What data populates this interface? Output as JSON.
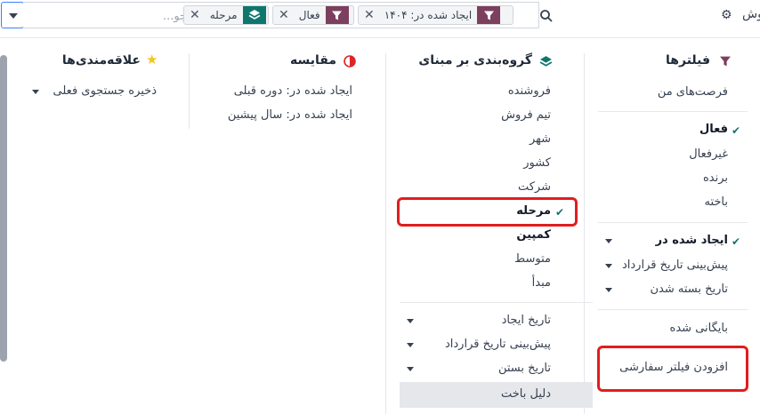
{
  "header": {
    "title": "وش",
    "search": {
      "placeholder": "جستجو..."
    },
    "facets": [
      {
        "label": "ایجاد شده در: ۱۴۰۴",
        "icon": "filter-icon"
      },
      {
        "label": "فعال",
        "icon": "filter-icon"
      },
      {
        "label": "مرحله",
        "icon": "layers-icon"
      }
    ],
    "remove_label": "✕"
  },
  "filters": {
    "heading": "فیلترها",
    "my_opportunities": "فرصت‌های من",
    "active": "فعال",
    "inactive": "غیرفعال",
    "won": "برنده",
    "lost": "باخته",
    "created_on": "ایجاد شده در",
    "expected_closing": "پیش‌بینی تاریخ قرارداد",
    "closed_date": "تاریخ بسته شدن",
    "archived": "بایگانی شده",
    "add_custom": "افزودن فیلتر سفارشی"
  },
  "groupby": {
    "heading": "گروه‌بندی بر مبنای",
    "items": [
      "فروشنده",
      "تیم فروش",
      "شهر",
      "کشور",
      "شرکت",
      "مرحله",
      "کمپین",
      "متوسط",
      "مبدأ"
    ],
    "date_items": [
      "تاریخ ایجاد",
      "پیش‌بینی تاریخ قرارداد",
      "تاریخ بستن"
    ],
    "lost_reason": "دلیل باخت"
  },
  "comparison": {
    "heading": "مقایسه",
    "previous_period": "ایجاد شده در: دوره قبلی",
    "previous_year": "ایجاد شده در: سال پیشین"
  },
  "favorites": {
    "heading": "علاقه‌مندی‌ها",
    "save_current": "ذخیره جستجوی فعلی"
  },
  "colors": {
    "filter_accent": "#7c3f5e",
    "groupby_accent": "#0f766e",
    "comparison_accent": "#dc2626",
    "favorites_accent": "#f5c518",
    "highlight_red": "#e11d1d"
  }
}
